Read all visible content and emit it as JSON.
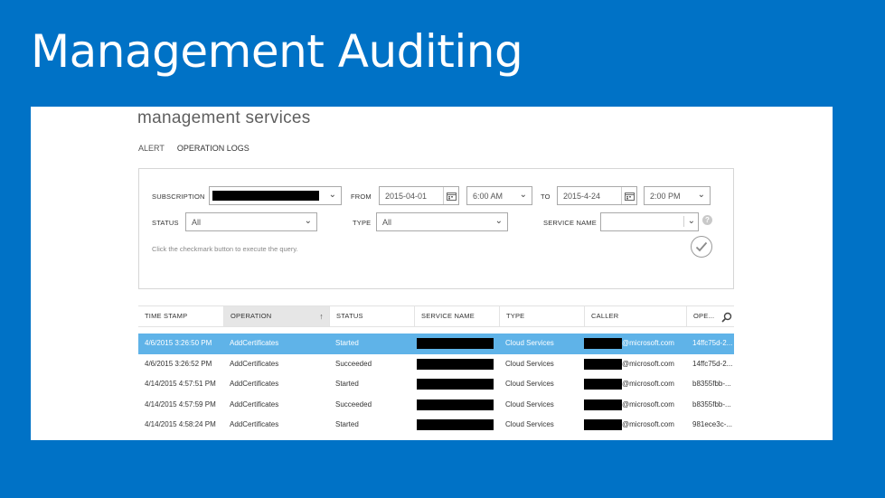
{
  "slide": {
    "title": "Management Auditing"
  },
  "app": {
    "title": "management services"
  },
  "tabs": [
    {
      "label": "ALERT",
      "active": false
    },
    {
      "label": "OPERATION LOGS",
      "active": true
    }
  ],
  "query": {
    "subscription_label": "SUBSCRIPTION",
    "from_label": "FROM",
    "from_date": "2015-04-01",
    "from_time": "6:00 AM",
    "to_label": "TO",
    "to_date": "2015-4-24",
    "to_time": "2:00 PM",
    "status_label": "STATUS",
    "status_value": "All",
    "type_label": "TYPE",
    "type_value": "All",
    "service_name_label": "SERVICE NAME",
    "hint": "Click the checkmark button to execute the query."
  },
  "grid": {
    "columns": [
      "TIME STAMP",
      "OPERATION",
      "STATUS",
      "SERVICE NAME",
      "TYPE",
      "CALLER",
      "OPE..."
    ],
    "rows": [
      {
        "timestamp": "4/6/2015 3:26:50 PM",
        "operation": "AddCertificates",
        "status": "Started",
        "type": "Cloud Services",
        "caller_domain": "@microsoft.com",
        "op_id": "14ffc75d-2...",
        "selected": true
      },
      {
        "timestamp": "4/6/2015 3:26:52 PM",
        "operation": "AddCertificates",
        "status": "Succeeded",
        "type": "Cloud Services",
        "caller_domain": "@microsoft.com",
        "op_id": "14ffc75d-2...",
        "selected": false
      },
      {
        "timestamp": "4/14/2015 4:57:51 PM",
        "operation": "AddCertificates",
        "status": "Started",
        "type": "Cloud Services",
        "caller_domain": "@microsoft.com",
        "op_id": "b8355fbb-...",
        "selected": false
      },
      {
        "timestamp": "4/14/2015 4:57:59 PM",
        "operation": "AddCertificates",
        "status": "Succeeded",
        "type": "Cloud Services",
        "caller_domain": "@microsoft.com",
        "op_id": "b8355fbb-...",
        "selected": false
      },
      {
        "timestamp": "4/14/2015 4:58:24 PM",
        "operation": "AddCertificates",
        "status": "Started",
        "type": "Cloud Services",
        "caller_domain": "@microsoft.com",
        "op_id": "981ece3c-...",
        "selected": false
      }
    ]
  },
  "colors": {
    "slide_bg": "#0072c6",
    "selected_row": "#5fb3e8",
    "redaction": "#000000"
  },
  "icons": [
    "chevron-down-icon",
    "calendar-icon",
    "help-icon",
    "checkmark-icon",
    "sort-up-arrow-icon",
    "search-icon"
  ]
}
